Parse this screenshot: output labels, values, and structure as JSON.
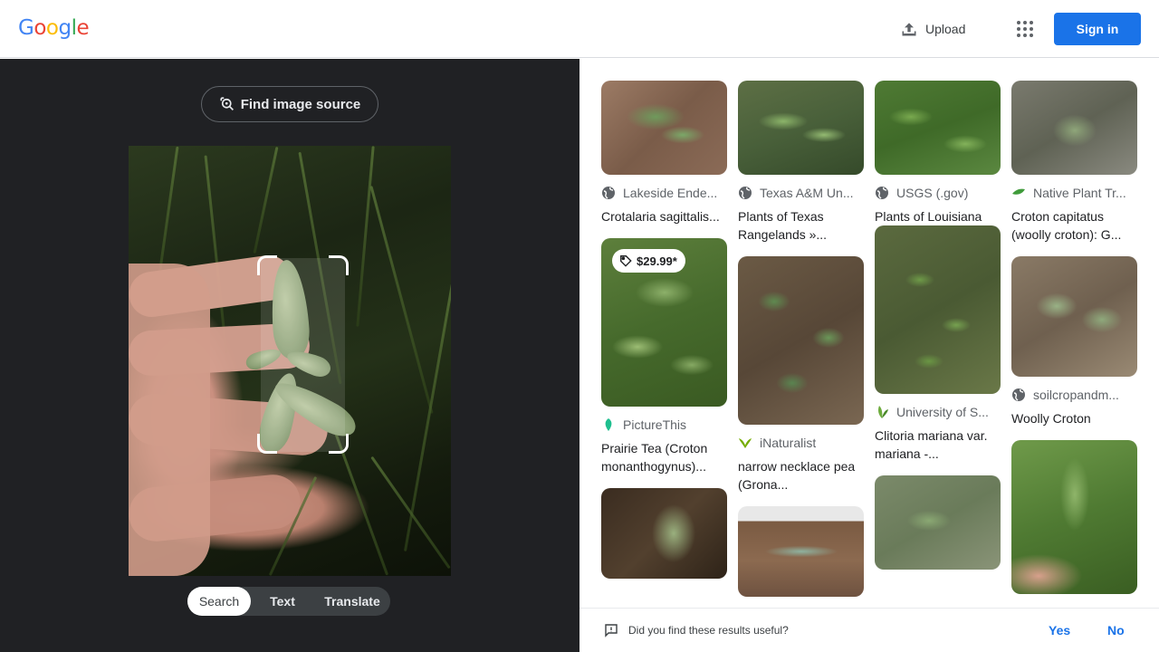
{
  "header": {
    "logo_letters": [
      "G",
      "o",
      "o",
      "g",
      "l",
      "e"
    ],
    "upload_label": "Upload",
    "signin_label": "Sign in"
  },
  "lens": {
    "find_source_label": "Find image source",
    "modes": [
      "Search",
      "Text",
      "Translate"
    ],
    "active_mode": "Search"
  },
  "results": {
    "cards": [
      {
        "source": "Lakeside Ende...",
        "title": "Crotalaria sagittalis...",
        "favicon": "globe-icon"
      },
      {
        "source": "Texas A&M Un...",
        "title": "Plants of Texas Rangelands »...",
        "favicon": "globe-icon"
      },
      {
        "source": "USGS (.gov)",
        "title": "Plants of Louisiana",
        "favicon": "globe-icon"
      },
      {
        "source": "Native Plant Tr...",
        "title": "Croton capitatus (woolly croton): G...",
        "favicon": "leaf-icon"
      },
      {
        "source": "PictureThis",
        "title": "Prairie Tea (Croton monanthogynus)...",
        "favicon": "picturethis-icon",
        "price": "$29.99*"
      },
      {
        "source": "iNaturalist",
        "title": "narrow necklace pea (Grona...",
        "favicon": "inaturalist-icon"
      },
      {
        "source": "University of S...",
        "title": "Clitoria mariana var. mariana -...",
        "favicon": "university-leaf-icon"
      },
      {
        "source": "soilcropandm...",
        "title": "Woolly Croton",
        "favicon": "globe-icon"
      }
    ]
  },
  "feedback": {
    "question": "Did you find these results useful?",
    "yes_label": "Yes",
    "no_label": "No"
  },
  "colors": {
    "accent": "#1a73e8",
    "dark_panel": "#202124",
    "logo": [
      "#4285F4",
      "#EA4335",
      "#FBBC05",
      "#4285F4",
      "#34A853",
      "#EA4335"
    ]
  }
}
